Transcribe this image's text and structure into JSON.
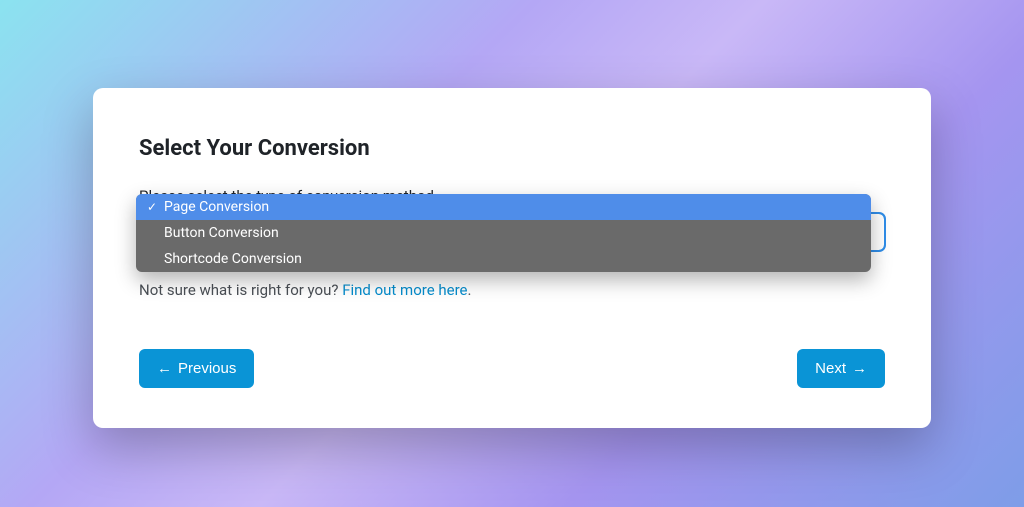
{
  "title": "Select Your Conversion",
  "prompt": "Please select the type of conversion method",
  "select_value": "Page Conversion",
  "hint_prefix": "Not sure what is right for you? ",
  "hint_link": "Find out more here",
  "hint_suffix": ".",
  "prev_label": "Previous",
  "next_label": "Next",
  "dropdown": {
    "items": [
      {
        "label": "Page Conversion",
        "selected": true
      },
      {
        "label": "Button Conversion",
        "selected": false
      },
      {
        "label": "Shortcode Conversion",
        "selected": false
      }
    ]
  }
}
